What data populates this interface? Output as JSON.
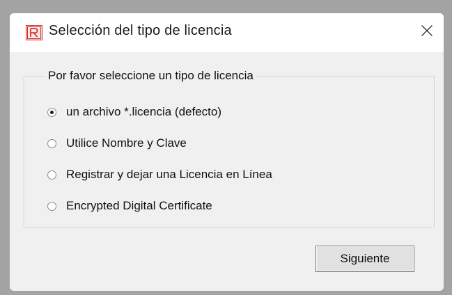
{
  "window": {
    "title": "Selección del tipo de licencia",
    "app_icon": "r-logo-icon",
    "close_icon": "close-icon"
  },
  "license_group": {
    "legend": "Por favor seleccione un tipo de licencia",
    "options": [
      {
        "label": "un archivo *.licencia (defecto)",
        "checked": true
      },
      {
        "label": "Utilice Nombre y Clave",
        "checked": false
      },
      {
        "label": "Registrar y dejar una Licencia en Línea",
        "checked": false
      },
      {
        "label": "Encrypted Digital Certificate",
        "checked": false
      }
    ]
  },
  "buttons": {
    "next_label": "Siguiente"
  },
  "colors": {
    "backdrop": "#a3a3a3",
    "dialog_bg": "#f0f0f0",
    "titlebar_bg": "#ffffff",
    "app_icon_accent": "#d9312b"
  }
}
